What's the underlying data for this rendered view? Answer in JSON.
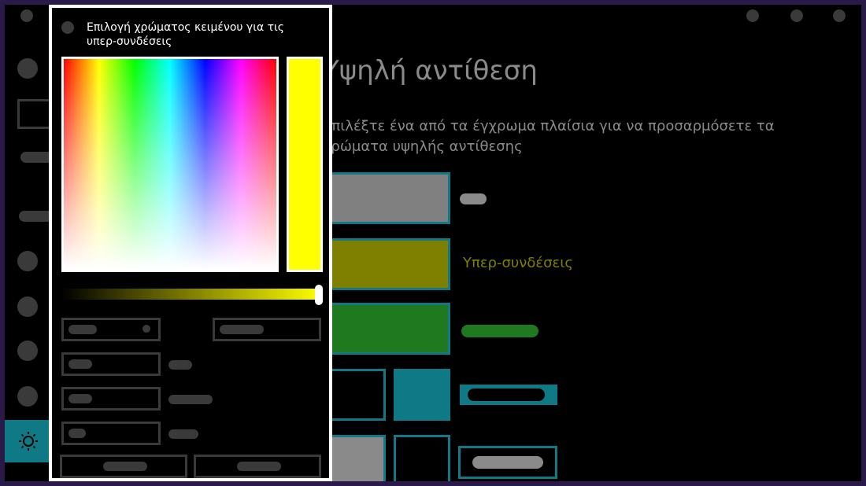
{
  "settings": {
    "title": "Υψηλή αντίθεση",
    "description": "Επιλέξτε ένα από τα έγχρωμα πλαίσια για να προσαρμόσετε τα χρώματα υψηλής αντίθεσης",
    "rows": [
      {
        "swatch_color": "#808080",
        "label": ""
      },
      {
        "swatch_color": "#808000",
        "label": "Υπερ-συνδέσεις",
        "label_color": "#808000"
      },
      {
        "swatch_color": "#1f7a1f",
        "label": ""
      }
    ]
  },
  "sidebar": {
    "active_icon": "sun-icon",
    "accent_color": "#0f7a86"
  },
  "color_dialog": {
    "title": "Επιλογή χρώματος κειμένου για τις υπερ-συνδέσεις",
    "selected_color": "#ffff00"
  },
  "colors": {
    "accent": "#0f7a86",
    "dialog_border": "#ffffff"
  }
}
